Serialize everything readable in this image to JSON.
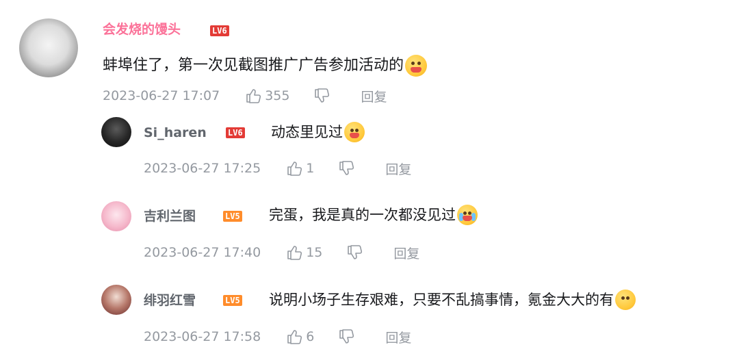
{
  "comment": {
    "username": "会发烧的馒头",
    "level": "LV6",
    "text": "蚌埠住了，第一次见截图推广广告参加活动的",
    "emoji": "angry-shout-emoji",
    "time": "2023-06-27 17:07",
    "likes": "355",
    "reply_label": "回复"
  },
  "replies": [
    {
      "username": "Si_haren",
      "level": "LV6",
      "text": "动态里见过",
      "emoji": "drooling-emoji",
      "time": "2023-06-27 17:25",
      "likes": "1",
      "reply_label": "回复"
    },
    {
      "username": "吉利兰图",
      "level": "LV5",
      "text": "完蛋，我是真的一次都没见过",
      "emoji": "crying-emoji",
      "time": "2023-06-27 17:40",
      "likes": "15",
      "reply_label": "回复"
    },
    {
      "username": "绯羽红雪",
      "level": "LV5",
      "text": "说明小场子生存艰难，只要不乱搞事情，氪金大大的有",
      "emoji": "smirk-emoji",
      "time": "2023-06-27 17:58",
      "likes": "6",
      "reply_label": "回复"
    }
  ],
  "colors": {
    "vip_name": "#fb7299",
    "name": "#61666d",
    "meta": "#9499a0",
    "lv6": "#e33b36",
    "lv5": "#ff8c2b"
  }
}
